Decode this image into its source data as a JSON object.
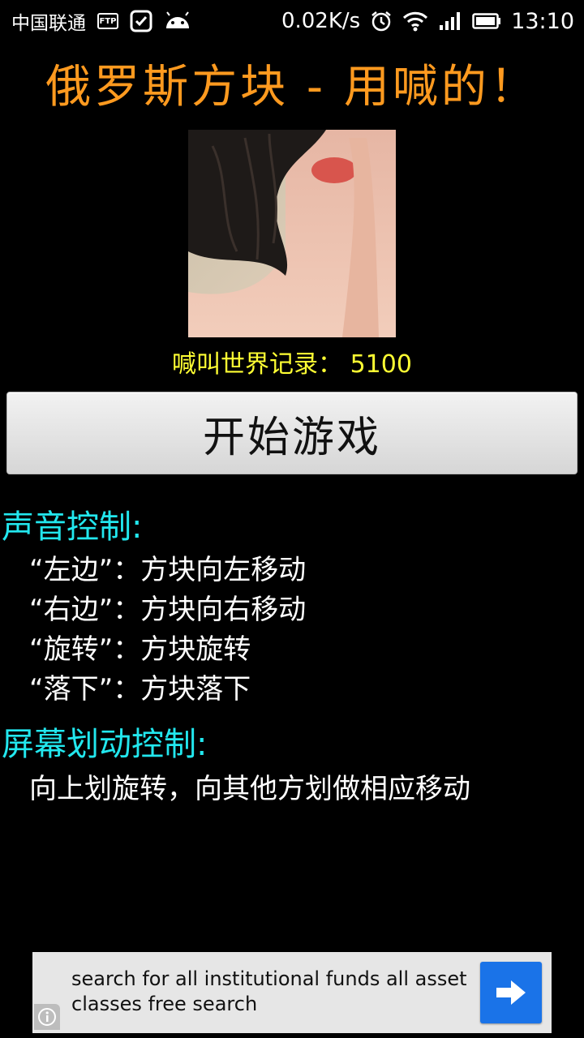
{
  "status_bar": {
    "carrier": "中国联通",
    "ftp_label": "FTP",
    "net_speed": "0.02K/s",
    "time": "13:10"
  },
  "app": {
    "title": "俄罗斯方块 - 用喊的！",
    "record": "喊叫世界记录： 5100",
    "start_button": "开始游戏"
  },
  "voice_control": {
    "heading": "声音控制:",
    "items": [
      "“左边”：方块向左移动",
      "“右边”：方块向右移动",
      "“旋转”：方块旋转",
      "“落下”：方块落下"
    ]
  },
  "swipe_control": {
    "heading": "屏幕划动控制:",
    "description": "向上划旋转，向其他方划做相应移动"
  },
  "ad": {
    "text": "search for all institutional funds all asset classes free search",
    "button_icon": "arrow-right-icon",
    "info_icon": "info-icon"
  },
  "colors": {
    "title": "#ff9a1f",
    "record": "#ffff33",
    "section_heading": "#22e7ee",
    "ad_button": "#1a73e8"
  }
}
